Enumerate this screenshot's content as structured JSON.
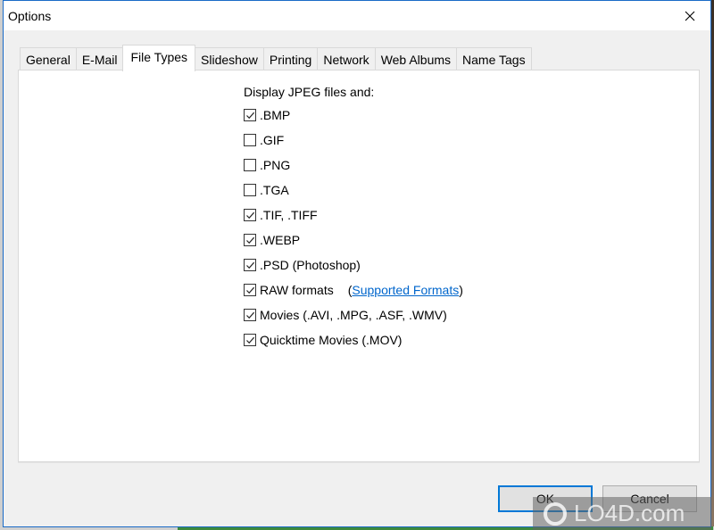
{
  "window": {
    "title": "Options",
    "close_icon": "close-icon"
  },
  "tabs": [
    {
      "label": "General",
      "active": false
    },
    {
      "label": "E-Mail",
      "active": false
    },
    {
      "label": "File Types",
      "active": true
    },
    {
      "label": "Slideshow",
      "active": false
    },
    {
      "label": "Printing",
      "active": false
    },
    {
      "label": "Network",
      "active": false
    },
    {
      "label": "Web Albums",
      "active": false
    },
    {
      "label": "Name Tags",
      "active": false
    }
  ],
  "file_types": {
    "heading": "Display JPEG files and:",
    "options": [
      {
        "label": ".BMP",
        "checked": true
      },
      {
        "label": ".GIF",
        "checked": false
      },
      {
        "label": ".PNG",
        "checked": false
      },
      {
        "label": ".TGA",
        "checked": false
      },
      {
        "label": ".TIF, .TIFF",
        "checked": true
      },
      {
        "label": ".WEBP",
        "checked": true
      },
      {
        "label": ".PSD (Photoshop)",
        "checked": true
      },
      {
        "label": "RAW formats",
        "checked": true
      },
      {
        "label": "Movies (.AVI, .MPG, .ASF, .WMV)",
        "checked": true
      },
      {
        "label": "Quicktime Movies (.MOV)",
        "checked": true
      }
    ],
    "raw_link": {
      "open_paren": "(",
      "text": "Supported Formats",
      "close_paren": ")"
    }
  },
  "buttons": {
    "ok": "OK",
    "cancel": "Cancel"
  },
  "watermark": {
    "text": "LO4D.com"
  },
  "colors": {
    "accent": "#0078d7",
    "link": "#0066cc",
    "dialog_border": "#1a6bc7"
  }
}
